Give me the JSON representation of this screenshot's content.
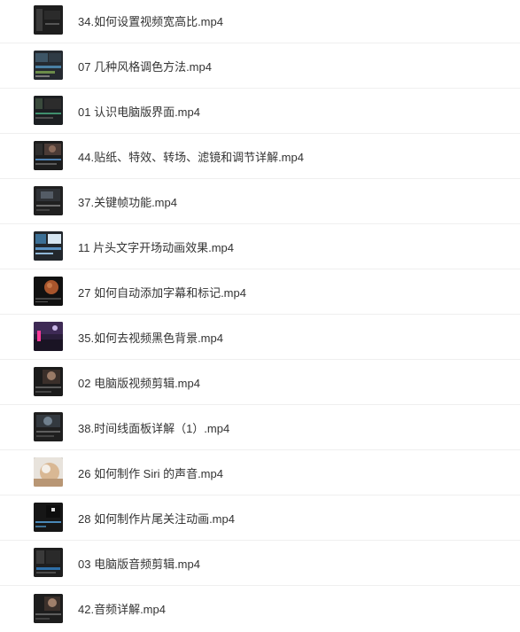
{
  "files": [
    {
      "name": "34.如何设置视频宽高比.mp4",
      "icon": "video-thumbnail-icon"
    },
    {
      "name": "07 几种风格调色方法.mp4",
      "icon": "video-thumbnail-icon"
    },
    {
      "name": "01 认识电脑版界面.mp4",
      "icon": "video-thumbnail-icon"
    },
    {
      "name": "44.贴纸、特效、转场、滤镜和调节详解.mp4",
      "icon": "video-thumbnail-icon"
    },
    {
      "name": "37.关键帧功能.mp4",
      "icon": "video-thumbnail-icon"
    },
    {
      "name": "11 片头文字开场动画效果.mp4",
      "icon": "video-thumbnail-icon"
    },
    {
      "name": "27 如何自动添加字幕和标记.mp4",
      "icon": "video-thumbnail-icon"
    },
    {
      "name": "35.如何去视频黑色背景.mp4",
      "icon": "video-thumbnail-icon"
    },
    {
      "name": "02 电脑版视频剪辑.mp4",
      "icon": "video-thumbnail-icon"
    },
    {
      "name": "38.时间线面板详解（1）.mp4",
      "icon": "video-thumbnail-icon"
    },
    {
      "name": "26 如何制作 Siri 的声音.mp4",
      "icon": "video-thumbnail-icon"
    },
    {
      "name": "28 如何制作片尾关注动画.mp4",
      "icon": "video-thumbnail-icon"
    },
    {
      "name": "03 电脑版音频剪辑.mp4",
      "icon": "video-thumbnail-icon"
    },
    {
      "name": "42.音频详解.mp4",
      "icon": "video-thumbnail-icon"
    }
  ]
}
